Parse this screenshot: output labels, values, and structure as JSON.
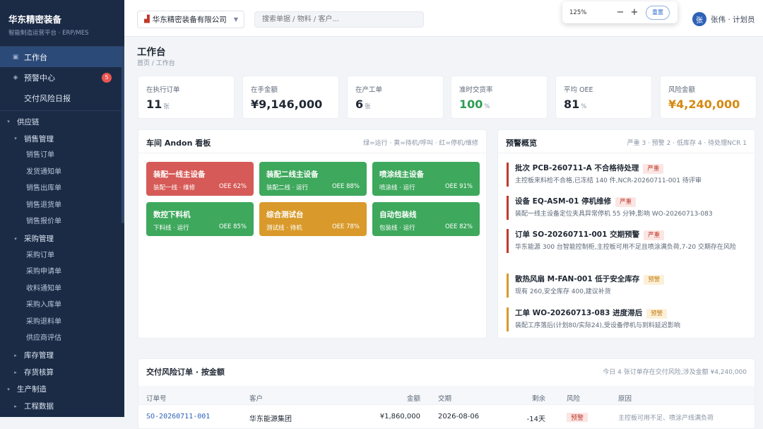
{
  "app": {
    "name": "华东精密装备",
    "subtitle": "智能制造运营平台 · ERP/MES"
  },
  "nav_top": [
    {
      "icon": "grid-icon",
      "glyph": "▣",
      "label": "工作台",
      "active": true
    },
    {
      "icon": "alert-icon",
      "glyph": "◈",
      "label": "预警中心",
      "badge": "5"
    },
    {
      "icon": "",
      "glyph": "",
      "label": "交付风险日报"
    }
  ],
  "nav_tree": [
    {
      "type": "l1",
      "label": "供应链"
    },
    {
      "type": "l2",
      "label": "销售管理"
    },
    {
      "type": "leaf",
      "label": "销售订单"
    },
    {
      "type": "leaf",
      "label": "发货通知单"
    },
    {
      "type": "leaf",
      "label": "销售出库单"
    },
    {
      "type": "leaf",
      "label": "销售退货单"
    },
    {
      "type": "leaf",
      "label": "销售报价单"
    },
    {
      "type": "l2",
      "label": "采购管理"
    },
    {
      "type": "leaf",
      "label": "采购订单"
    },
    {
      "type": "leaf",
      "label": "采购申请单"
    },
    {
      "type": "leaf",
      "label": "收料通知单"
    },
    {
      "type": "leaf",
      "label": "采购入库单"
    },
    {
      "type": "leaf",
      "label": "采购退料单"
    },
    {
      "type": "leaf",
      "label": "供应商评估"
    },
    {
      "type": "l2c",
      "label": "库存管理"
    },
    {
      "type": "l2c",
      "label": "存货核算"
    },
    {
      "type": "l1",
      "label": "生产制造"
    },
    {
      "type": "l2c",
      "label": "工程数据"
    }
  ],
  "header": {
    "company": "华东精密装备有限公司",
    "search_placeholder": "搜索单据 / 物料 / 客户...",
    "zoom": "125%",
    "zoom_minus": "−",
    "zoom_plus": "+",
    "zoom_reset": "重置",
    "user_avatar": "张",
    "user": "张伟 · 计划员"
  },
  "page": {
    "title": "工作台",
    "breadcrumb": "首页 / 工作台"
  },
  "kpis": [
    {
      "label": "在执行订单",
      "value": "11",
      "unit": "张",
      "color": "#1f2733"
    },
    {
      "label": "在手金额",
      "value": "¥9,146,000",
      "unit": "",
      "color": "#1f2733"
    },
    {
      "label": "在产工单",
      "value": "6",
      "unit": "张",
      "color": "#1f2733"
    },
    {
      "label": "准时交货率",
      "value": "100",
      "unit": "%",
      "color": "#2e9e54"
    },
    {
      "label": "平均 OEE",
      "value": "81",
      "unit": "%",
      "color": "#1f2733"
    },
    {
      "label": "风险金额",
      "value": "¥4,240,000",
      "unit": "",
      "color": "#d68910"
    }
  ],
  "andon": {
    "title": "车间 Andon 看板",
    "legend": "绿=运行 · 黄=待机/呼叫 · 红=停机/维修",
    "tiles": [
      {
        "name": "装配一线主设备",
        "sub": "装配一线 · 维修",
        "oee": "OEE 62%",
        "color": "#d65a57"
      },
      {
        "name": "装配二线主设备",
        "sub": "装配二线 · 运行",
        "oee": "OEE 88%",
        "color": "#3ea85c"
      },
      {
        "name": "喷涂线主设备",
        "sub": "喷涂线 · 运行",
        "oee": "OEE 91%",
        "color": "#3ea85c"
      },
      {
        "name": "数控下料机",
        "sub": "下料线 · 运行",
        "oee": "OEE 85%",
        "color": "#3ea85c"
      },
      {
        "name": "综合测试台",
        "sub": "测试线 · 待机",
        "oee": "OEE 78%",
        "color": "#d99a2b"
      },
      {
        "name": "自动包装线",
        "sub": "包装线 · 运行",
        "oee": "OEE 82%",
        "color": "#3ea85c"
      }
    ]
  },
  "alerts": {
    "title": "预警概览",
    "summary": "严重 3 · 预警 2 · 低库存 4 · 待处理NCR 1",
    "items": [
      {
        "title": "批次 PCB-260711-A 不合格待处理",
        "tag": "严重",
        "level": "sev",
        "desc": "主控板来料检不合格,已冻结 140 件,NCR-20260711-001 待评审"
      },
      {
        "title": "设备 EQ-ASM-01 停机维修",
        "tag": "严重",
        "level": "sev",
        "desc": "装配一线主设备定位夹具异常停机 55 分钟,影响 WO-20260713-083"
      },
      {
        "title": "订单 SO-20260711-001 交期预警",
        "tag": "严重",
        "level": "sev",
        "desc": "华东能源 300 台智能控制柜,主控板可用不足且喷涂满负荷,7-20 交期存在风险"
      },
      {
        "title": "散热风扇 M-FAN-001 低于安全库存",
        "tag": "预警",
        "level": "warn",
        "desc": "现有 260,安全库存 400,建议补货"
      },
      {
        "title": "工单 WO-20260713-083 进度滞后",
        "tag": "预警",
        "level": "warn",
        "desc": "装配工序落后(计划80/实际24),受设备停机与到料延迟影响"
      }
    ]
  },
  "risk_table": {
    "title": "交付风险订单 · 按金额",
    "note": "今日 4 张订单存在交付风险,涉及金额 ¥4,240,000",
    "headers": [
      "订单号",
      "客户",
      "金额",
      "交期",
      "剩余",
      "风险",
      "原因"
    ],
    "rows": [
      {
        "order": "SO-20260711-001",
        "customer": "华东能源集团",
        "amount": "¥1,860,000",
        "date": "2026-08-06",
        "remain": "-14天",
        "risk": "预警",
        "reason": "主控板可用不足、喷涂产线满负荷"
      }
    ]
  },
  "colors": {
    "sidebar": "#1b2b46",
    "accent": "#2e62b7",
    "ok": "#3ea85c",
    "warn": "#d99a2b",
    "danger": "#d65a57"
  }
}
